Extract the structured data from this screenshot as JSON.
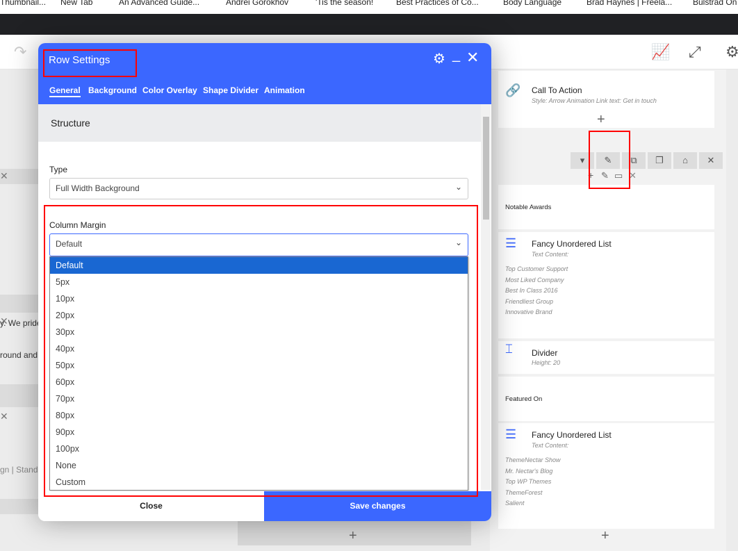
{
  "browser": {
    "bookmarks": [
      "Thumbnail...",
      "New Tab",
      "An Advanced Guide...",
      "Andrei Gorokhov",
      "'Tis the season!",
      "Best Practices of Co...",
      "Body Language",
      "Brad Haynes | Freela...",
      "Bulstrad On"
    ]
  },
  "toolbar": {
    "icons": [
      "redo-icon",
      "presentation-icon",
      "fullscreen-icon",
      "settings-icon"
    ]
  },
  "background_left": {
    "text_1": "y. We pride",
    "text_2": "round and",
    "text_3": "gn | Standi"
  },
  "right_column": {
    "cta": {
      "title": "Call To Action",
      "subtitle": "Style: Arrow Animation  Link text: Get in touch"
    },
    "notable": "Notable Awards",
    "list1": {
      "title": "Fancy Unordered List",
      "subtitle": "Text Content:",
      "items": [
        "Top Customer Support",
        "Most Liked Company",
        "Best In Class 2016",
        "Friendliest Group",
        "Innovative Brand"
      ]
    },
    "divider": {
      "title": "Divider",
      "subtitle": "Height: 20"
    },
    "featured": "Featured On",
    "list2": {
      "title": "Fancy Unordered List",
      "subtitle": "Text Content:",
      "items": [
        "ThemeNectar Show",
        "Mr. Nectar's Blog",
        "Top WP Themes",
        "ThemeForest",
        "Salient"
      ]
    }
  },
  "modal": {
    "title": "Row Settings",
    "tabs": [
      "General",
      "Background",
      "Color Overlay",
      "Shape Divider",
      "Animation"
    ],
    "active_tab": "General",
    "section": "Structure",
    "type_label": "Type",
    "type_value": "Full Width Background",
    "margin_label": "Column Margin",
    "margin_value": "Default",
    "margin_options": [
      "Default",
      "5px",
      "10px",
      "20px",
      "30px",
      "40px",
      "50px",
      "60px",
      "70px",
      "80px",
      "90px",
      "100px",
      "None",
      "Custom"
    ],
    "close_label": "Close",
    "save_label": "Save changes"
  },
  "colors": {
    "accent": "#3b67ff",
    "highlight": "#1967d2",
    "annotation": "#ff0000"
  }
}
